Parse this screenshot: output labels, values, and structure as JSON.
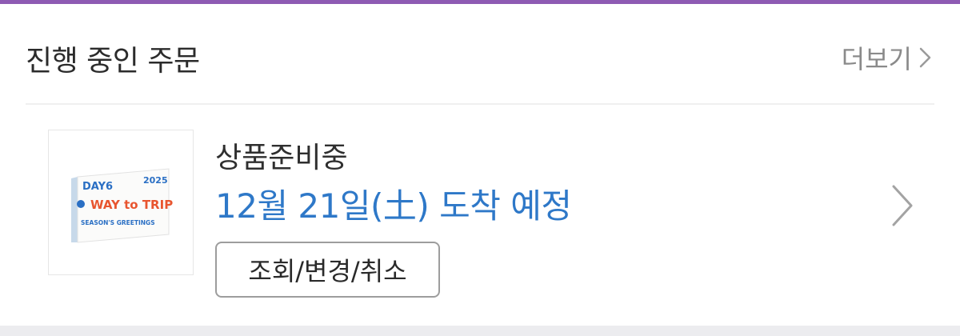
{
  "header": {
    "title": "진행 중인 주문",
    "more_label": "더보기",
    "more_icon": "chevron-right-icon"
  },
  "order": {
    "status": "상품준비중",
    "arrival": "12월 21일(土) 도착 예정",
    "action_label": "조회/변경/취소",
    "row_icon": "chevron-right-icon",
    "thumbnail": {
      "brand": "DAY6",
      "year": "2025",
      "title_line1": "WAY to TRIP",
      "title_line2": "SEASON'S GREETINGS"
    }
  },
  "colors": {
    "accent_bar": "#8e5bb3",
    "arrival_text": "#2e78c8",
    "muted_text": "#8a8a8a"
  }
}
